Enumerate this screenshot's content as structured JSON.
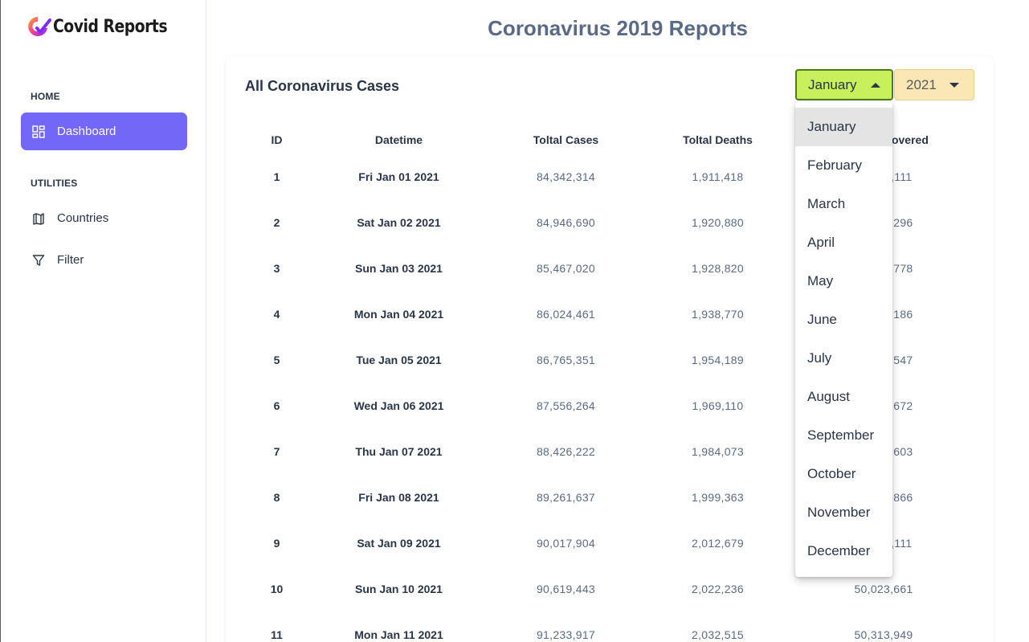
{
  "app": {
    "logo_text": "Covid Reports",
    "page_title": "Coronavirus 2019 Reports"
  },
  "sidebar": {
    "home_caption": "HOME",
    "utilities_caption": "UTILITIES",
    "items": [
      {
        "label": "Dashboard",
        "icon": "dashboard-icon",
        "active": true
      },
      {
        "label": "Countries",
        "icon": "map-icon",
        "active": false
      },
      {
        "label": "Filter",
        "icon": "filter-icon",
        "active": false
      }
    ]
  },
  "card": {
    "title": "All Coronavirus Cases",
    "month_select": {
      "value": "January",
      "open": true
    },
    "year_select": {
      "value": "2021"
    }
  },
  "table": {
    "headers": [
      "ID",
      "Datetime",
      "Toltal Cases",
      "Toltal Deaths",
      "Toltal Recovered"
    ],
    "rows": [
      [
        "1",
        "Fri Jan 01 2021",
        "84,342,314",
        "1,911,418",
        "47,491,111"
      ],
      [
        "2",
        "Sat Jan 02 2021",
        "84,946,690",
        "1,920,880",
        "47,705,296"
      ],
      [
        "3",
        "Sun Jan 03 2021",
        "85,467,020",
        "1,928,820",
        "47,935,778"
      ],
      [
        "4",
        "Mon Jan 04 2021",
        "86,024,461",
        "1,938,770",
        "48,262,186"
      ],
      [
        "5",
        "Tue Jan 05 2021",
        "86,765,351",
        "1,954,189",
        "48,545,547"
      ],
      [
        "6",
        "Wed Jan 06 2021",
        "87,556,264",
        "1,969,110",
        "48,829,672"
      ],
      [
        "7",
        "Thu Jan 07 2021",
        "88,426,222",
        "1,984,073",
        "49,163,603"
      ],
      [
        "8",
        "Fri Jan 08 2021",
        "89,261,637",
        "1,999,363",
        "49,448,866"
      ],
      [
        "9",
        "Sat Jan 09 2021",
        "90,017,904",
        "2,012,679",
        "49,756,111"
      ],
      [
        "10",
        "Sun Jan 10 2021",
        "90,619,443",
        "2,022,236",
        "50,023,661"
      ],
      [
        "11",
        "Mon Jan 11 2021",
        "91,233,917",
        "2,032,515",
        "50,313,949"
      ]
    ]
  },
  "month_dropdown": {
    "options": [
      "January",
      "February",
      "March",
      "April",
      "May",
      "June",
      "July",
      "August",
      "September",
      "October",
      "November",
      "December"
    ],
    "selected_index": 0
  },
  "colors": {
    "accent": "#7367f8",
    "month_select_bg": "#c8f05a",
    "year_select_bg": "#fbe7b5"
  }
}
